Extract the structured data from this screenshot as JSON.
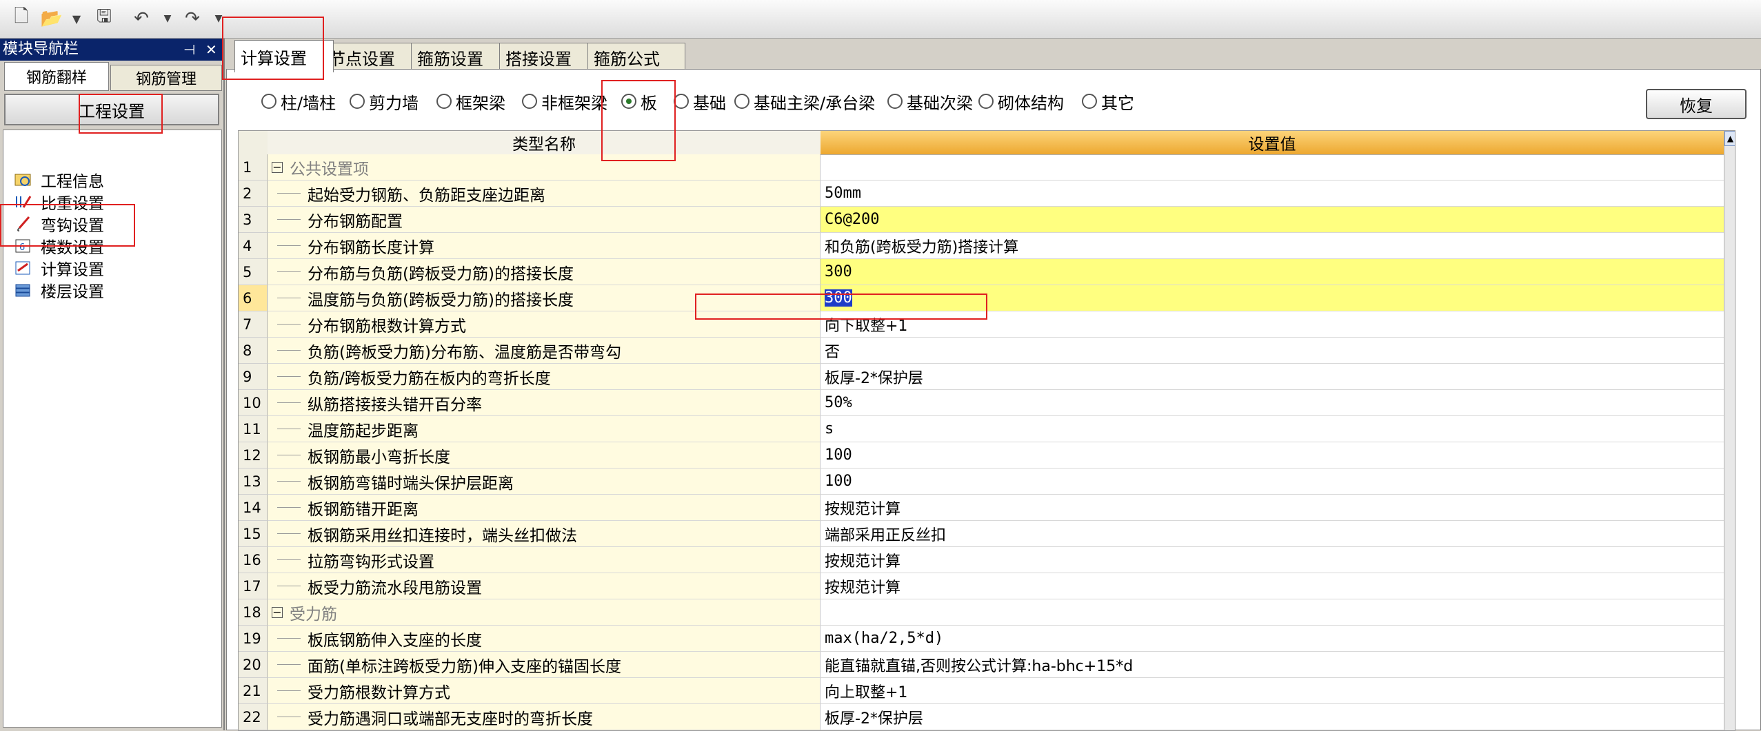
{
  "nav": {
    "title": "模块导航栏",
    "pin": "⊣",
    "close": "✕",
    "tabs": [
      "钢筋翻样",
      "钢筋管理"
    ],
    "header": "工程设置",
    "items": [
      "工程信息",
      "比重设置",
      "弯钩设置",
      "模数设置",
      "计算设置",
      "楼层设置"
    ]
  },
  "main": {
    "tabs": [
      "计算设置",
      "节点设置",
      "箍筋设置",
      "搭接设置",
      "箍筋公式"
    ],
    "categories": [
      "柱/墙柱",
      "剪力墙",
      "框架梁",
      "非框架梁",
      "板",
      "基础",
      "基础主梁/承台梁",
      "基础次梁",
      "砌体结构",
      "其它"
    ],
    "selected_category": "板",
    "restore_label": "恢复"
  },
  "grid": {
    "header_name": "类型名称",
    "header_value": "设置值",
    "rows": [
      {
        "n": "1",
        "name": "公共设置项",
        "value": "",
        "group": true
      },
      {
        "n": "2",
        "name": "起始受力钢筋、负筋距支座边距离",
        "value": "50mm"
      },
      {
        "n": "3",
        "name": "分布钢筋配置",
        "value": "C6@200",
        "hl": true
      },
      {
        "n": "4",
        "name": "分布钢筋长度计算",
        "value": "和负筋(跨板受力筋)搭接计算"
      },
      {
        "n": "5",
        "name": "分布筋与负筋(跨板受力筋)的搭接长度",
        "value": "300",
        "hl": true
      },
      {
        "n": "6",
        "name": "温度筋与负筋(跨板受力筋)的搭接长度",
        "value": "300",
        "hl": true,
        "sel": true
      },
      {
        "n": "7",
        "name": "分布钢筋根数计算方式",
        "value": "向下取整+1"
      },
      {
        "n": "8",
        "name": "负筋(跨板受力筋)分布筋、温度筋是否带弯勾",
        "value": "否"
      },
      {
        "n": "9",
        "name": "负筋/跨板受力筋在板内的弯折长度",
        "value": "板厚-2*保护层"
      },
      {
        "n": "10",
        "name": "纵筋搭接接头错开百分率",
        "value": "50%"
      },
      {
        "n": "11",
        "name": "温度筋起步距离",
        "value": "s"
      },
      {
        "n": "12",
        "name": "板钢筋最小弯折长度",
        "value": "100"
      },
      {
        "n": "13",
        "name": "板钢筋弯锚时端头保护层距离",
        "value": "100"
      },
      {
        "n": "14",
        "name": "板钢筋错开距离",
        "value": "按规范计算"
      },
      {
        "n": "15",
        "name": "板钢筋采用丝扣连接时，端头丝扣做法",
        "value": "端部采用正反丝扣"
      },
      {
        "n": "16",
        "name": "拉筋弯钩形式设置",
        "value": "按规范计算"
      },
      {
        "n": "17",
        "name": "板受力筋流水段甩筋设置",
        "value": "按规范计算"
      },
      {
        "n": "18",
        "name": "受力筋",
        "value": "",
        "group": true
      },
      {
        "n": "19",
        "name": "板底钢筋伸入支座的长度",
        "value": "max(ha/2,5*d)"
      },
      {
        "n": "20",
        "name": "面筋(单标注跨板受力筋)伸入支座的锚固长度",
        "value": "能直锚就直锚,否则按公式计算:ha-bhc+15*d"
      },
      {
        "n": "21",
        "name": "受力筋根数计算方式",
        "value": "向上取整+1"
      },
      {
        "n": "22",
        "name": "受力筋遇洞口或端部无支座时的弯折长度",
        "value": "板厚-2*保护层"
      }
    ]
  },
  "colors": {
    "accent_red": "#e02020",
    "highlight": "#ffff80",
    "header_orange": "#f0b040",
    "title_bar": "#0a246a"
  }
}
